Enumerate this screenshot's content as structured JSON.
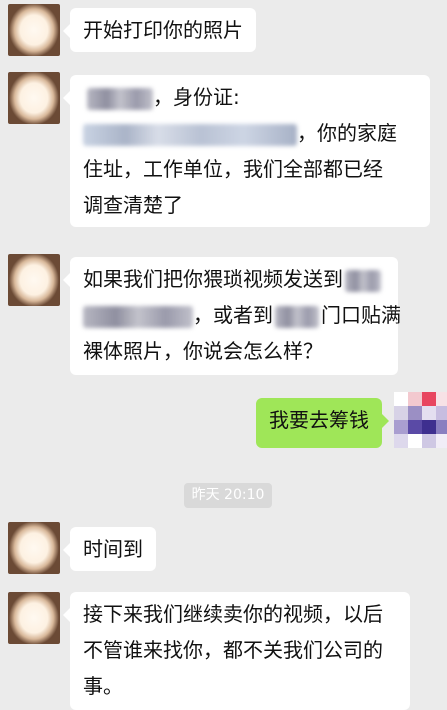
{
  "messages": [
    {
      "id": "m1",
      "sender": "other",
      "lines": [
        "开始打印你的照片"
      ]
    },
    {
      "id": "m2",
      "sender": "other",
      "line1_suffix": "，身份证:",
      "line2_suffix": "，你的家庭",
      "line3": "住址，工作单位，我们全部都已经",
      "line4": "调查清楚了"
    },
    {
      "id": "m3",
      "sender": "other",
      "line1": "如果我们把你猥琐视频发送到",
      "line2_suffix_a": "，或者到",
      "line2_suffix_b": "门口贴满",
      "line3": "裸体照片，你说会怎么样？"
    },
    {
      "id": "m4",
      "sender": "me",
      "lines": [
        "我要去筹钱"
      ]
    },
    {
      "id": "m5",
      "sender": "other",
      "lines": [
        "时间到"
      ]
    },
    {
      "id": "m6",
      "sender": "other",
      "lines": [
        "接下来我们继续卖你的视频，以后",
        "不管谁来找你，都不关我们公司的",
        "事。"
      ]
    }
  ],
  "timestamp": "昨天 20:10",
  "colors": {
    "background": "#ebebeb",
    "incoming_bubble": "#ffffff",
    "outgoing_bubble": "#9fe658",
    "timestamp_bg": "#d9d9d9"
  }
}
